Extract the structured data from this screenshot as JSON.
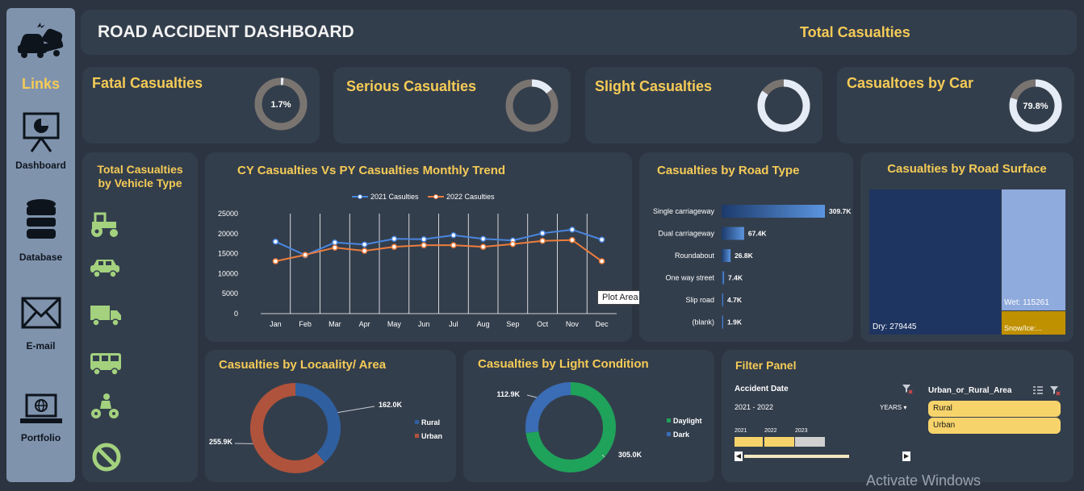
{
  "header": {
    "title": "ROAD ACCIDENT DASHBOARD",
    "total_label": "Total Casualties"
  },
  "sidebar": {
    "links_label": "Links",
    "items": [
      {
        "label": "Dashboard",
        "icon": "presentation-chart-icon"
      },
      {
        "label": "Database",
        "icon": "database-icon"
      },
      {
        "label": "E-mail",
        "icon": "envelope-icon"
      },
      {
        "label": "Portfolio",
        "icon": "laptop-globe-icon"
      }
    ]
  },
  "kpis": [
    {
      "title": "Fatal Casualties",
      "value_label": "1.7%",
      "fraction": 0.017
    },
    {
      "title": "Serious Casualties",
      "value_label": "",
      "fraction": 0.14
    },
    {
      "title": "Slight Casualties",
      "value_label": "",
      "fraction": 0.845
    },
    {
      "title": "Casualtoes by Car",
      "value_label": "79.8%",
      "fraction": 0.798
    }
  ],
  "vehicle_panel": {
    "title_line1": "Total Casualties",
    "title_line2": "by Vehicle Type",
    "icons": [
      "tractor-icon",
      "car-icon",
      "truck-icon",
      "bus-icon",
      "motorcycle-icon",
      "no-entry-icon"
    ]
  },
  "trend": {
    "title": "CY Casualties Vs PY Casualties Monthly Trend",
    "tooltip": "Plot Area"
  },
  "road_type": {
    "title": "Casualties by Road Type"
  },
  "surface": {
    "title": "Casualties by Road Surface",
    "dry_label": "Dry: 279445",
    "wet_label": "Wet: 115261",
    "snow_label": "Snow/Ice:..."
  },
  "locality": {
    "title": "Casualties by Locaality/ Area"
  },
  "light": {
    "title": "Casualties by Light Condition"
  },
  "filter": {
    "title": "Filter Panel",
    "date_label": "Accident Date",
    "date_range": "2021 - 2022",
    "years_label": "YEARS",
    "years": [
      "2021",
      "2022",
      "2023"
    ],
    "area_label": "Urban_or_Rural_Area",
    "area_items": [
      "Rural",
      "Urban"
    ]
  },
  "watermark": "Activate Windows",
  "colors": {
    "accent": "#f5cb57",
    "panel": "#333e4c",
    "cy": "#4a86e0",
    "py": "#ee7d3c",
    "green": "#1fa25a"
  },
  "chart_data": [
    {
      "type": "line",
      "title": "CY Casualties Vs PY Casualties Monthly Trend",
      "categories": [
        "Jan",
        "Feb",
        "Mar",
        "Apr",
        "May",
        "Jun",
        "Jul",
        "Aug",
        "Sep",
        "Oct",
        "Nov",
        "Dec"
      ],
      "series": [
        {
          "name": "2021 Casulties",
          "values": [
            18000,
            14600,
            17800,
            17300,
            18700,
            18600,
            19600,
            18700,
            18300,
            20100,
            21000,
            18500
          ]
        },
        {
          "name": "2022 Casulties",
          "values": [
            13100,
            14700,
            16500,
            15700,
            16700,
            17100,
            17100,
            16700,
            17400,
            18200,
            18400,
            13100
          ]
        }
      ],
      "yticks": [
        "25000",
        "20000",
        "15000",
        "10000",
        "5000",
        "0"
      ],
      "ylim": [
        0,
        25000
      ],
      "grid": "vertical",
      "legend": "top"
    },
    {
      "type": "bar",
      "title": "Casualties by Road Type",
      "categories": [
        "Single carriageway",
        "Dual carriageway",
        "Roundabout",
        "One way street",
        "Slip road",
        "(blank)"
      ],
      "values": [
        309.7,
        67.4,
        26.8,
        7.4,
        4.7,
        1.9
      ],
      "labels": [
        "309.7K",
        "67.4K",
        "26.8K",
        "7.4K",
        "4.7K",
        "1.9K"
      ],
      "orientation": "horizontal"
    },
    {
      "type": "treemap",
      "title": "Casualties by Road Surface",
      "categories": [
        "Dry",
        "Wet",
        "Snow/Ice"
      ],
      "values": [
        279445,
        115261,
        21000
      ]
    },
    {
      "type": "pie",
      "title": "Casualties by Locaality/ Area",
      "series": [
        {
          "name": "Rural",
          "value": 162.0,
          "label": "162.0K",
          "color": "#2f5f9e"
        },
        {
          "name": "Urban",
          "value": 255.9,
          "label": "255.9K",
          "color": "#b0533c"
        }
      ],
      "legend": "right"
    },
    {
      "type": "pie",
      "title": "Casualties by Light Condition",
      "series": [
        {
          "name": "Daylight",
          "value": 305.0,
          "label": "305.0K",
          "color": "#1fa25a"
        },
        {
          "name": "Dark",
          "value": 112.9,
          "label": "112.9K",
          "color": "#3a6db5"
        }
      ],
      "legend": "right"
    }
  ]
}
